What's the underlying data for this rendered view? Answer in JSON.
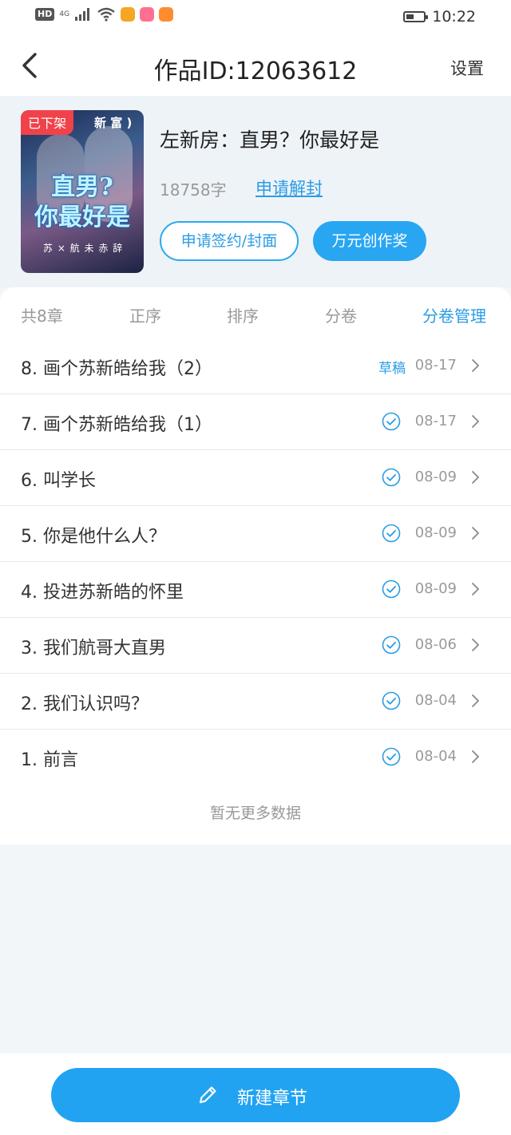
{
  "status_bar": {
    "network_badge": "HD",
    "signal_label": "4G",
    "time": "10:22",
    "battery_level": 0.45,
    "app_icons": [
      {
        "name": "weibo-icon",
        "color": "#f5a623"
      },
      {
        "name": "app-icon-pink",
        "color": "#ff6f91"
      },
      {
        "name": "app-icon-orange",
        "color": "#ff8c2e"
      }
    ]
  },
  "nav": {
    "title": "作品ID:12063612",
    "settings_label": "设置"
  },
  "book": {
    "cover_badge": "已下架",
    "cover_top_text": "新 富 )",
    "cover_title_line1": "直男?",
    "cover_title_line2": "你最好是",
    "cover_bottom_text": "苏 × 航 未 赤 辞",
    "title": "左新房：直男？你最好是",
    "word_count": "18758字",
    "unseal_link": "申请解封",
    "sign_button": "申请签约/封面",
    "award_button": "万元创作奖"
  },
  "tabs": {
    "total": "共8章",
    "order": "正序",
    "sort": "排序",
    "volume": "分卷",
    "volume_manage": "分卷管理"
  },
  "chapters": [
    {
      "title": "8. 画个苏新皓给我（2）",
      "status": "草稿",
      "date": "08-17"
    },
    {
      "title": "7. 画个苏新皓给我（1）",
      "status": "",
      "date": "08-17"
    },
    {
      "title": "6. 叫学长",
      "status": "",
      "date": "08-09"
    },
    {
      "title": "5. 你是他什么人？",
      "status": "",
      "date": "08-09"
    },
    {
      "title": "4. 投进苏新皓的怀里",
      "status": "",
      "date": "08-09"
    },
    {
      "title": "3. 我们航哥大直男",
      "status": "",
      "date": "08-06"
    },
    {
      "title": "2. 我们认识吗？",
      "status": "",
      "date": "08-04"
    },
    {
      "title": "1. 前言",
      "status": "",
      "date": "08-04"
    }
  ],
  "list_footer": "暂无更多数据",
  "bottom": {
    "new_chapter_label": "新建章节"
  },
  "colors": {
    "accent": "#2a9ce5",
    "badge_red": "#f0424a",
    "background": "#f3f6f9"
  }
}
